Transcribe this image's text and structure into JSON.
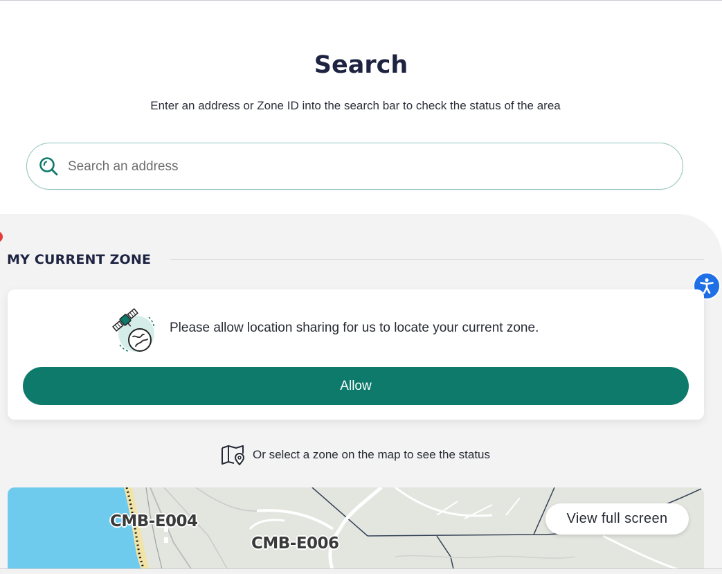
{
  "header": {
    "title": "Search",
    "subtitle": "Enter an address or Zone ID into the search bar to check the status of the area"
  },
  "search": {
    "placeholder": "Search an address",
    "value": "",
    "icon": "search-icon"
  },
  "current_zone": {
    "heading": "MY CURRENT ZONE",
    "message": "Please allow location sharing for us to locate your current zone.",
    "allow_label": "Allow",
    "illustration_icon": "satellite-globe-icon"
  },
  "map_hint": {
    "text": "Or select a zone on the map to see the status",
    "icon": "map-pin-icon"
  },
  "map": {
    "fullscreen_label": "View full screen",
    "zones": [
      "CMB-E004",
      "CMB-E006"
    ]
  },
  "accessibility": {
    "icon": "accessibility-icon"
  },
  "colors": {
    "primary": "#0d7a6b",
    "title": "#1d2340",
    "panel": "#f3f3f4",
    "water": "#6fcbed",
    "accessibility": "#1f6fe6"
  }
}
